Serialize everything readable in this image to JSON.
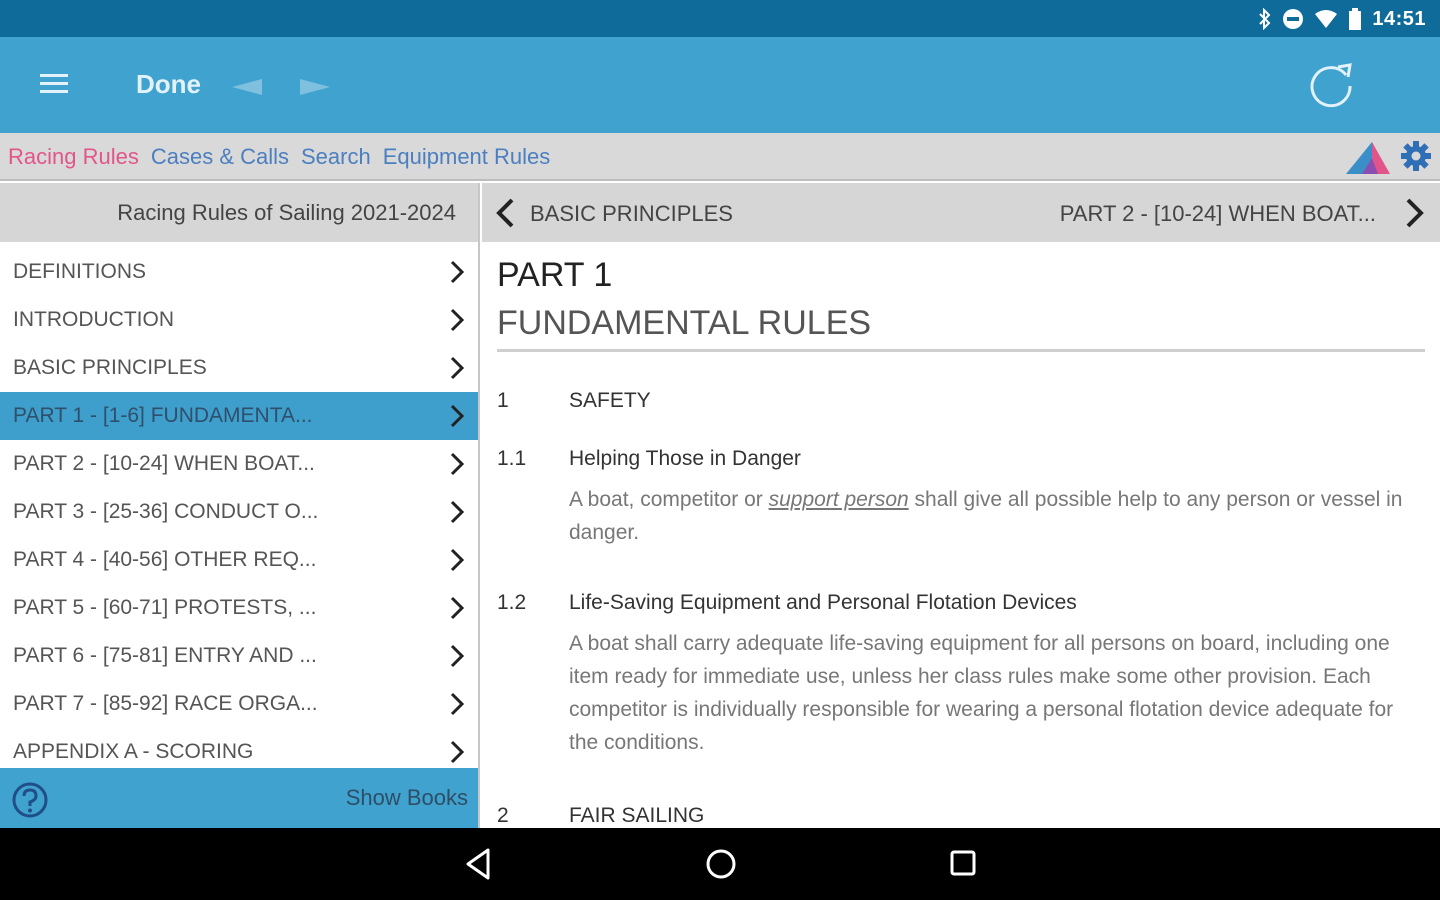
{
  "status_bar": {
    "time": "14:51",
    "icons": [
      "bluetooth-icon",
      "do-not-disturb-icon",
      "wifi-icon",
      "battery-icon"
    ]
  },
  "app_bar": {
    "menu_icon": "hamburger-menu-icon",
    "done_label": "Done",
    "back_icon": "arrow-left-icon",
    "forward_icon": "arrow-right-icon",
    "refresh_icon": "refresh-icon"
  },
  "tabs": [
    {
      "label": "Racing Rules",
      "active": true
    },
    {
      "label": "Cases & Calls",
      "active": false
    },
    {
      "label": "Search",
      "active": false
    },
    {
      "label": "Equipment Rules",
      "active": false
    }
  ],
  "sidebar": {
    "header": "Racing Rules of Sailing 2021-2024",
    "items": [
      {
        "label": "DEFINITIONS"
      },
      {
        "label": "INTRODUCTION"
      },
      {
        "label": "BASIC PRINCIPLES"
      },
      {
        "label": "PART 1 - [1-6] FUNDAMENTA..."
      },
      {
        "label": "PART 2 - [10-24] WHEN BOAT..."
      },
      {
        "label": "PART 3 - [25-36] CONDUCT O..."
      },
      {
        "label": "PART 4 - [40-56] OTHER REQ..."
      },
      {
        "label": "PART 5 - [60-71] PROTESTS, ..."
      },
      {
        "label": "PART 6 - [75-81] ENTRY AND ..."
      },
      {
        "label": "PART 7 - [85-92] RACE ORGA..."
      },
      {
        "label": "APPENDIX A - SCORING"
      }
    ],
    "selected_index": 3,
    "footer": {
      "help_icon": "help-icon",
      "show_books_label": "Show Books"
    }
  },
  "content": {
    "prev_label": "BASIC PRINCIPLES",
    "next_label": "PART 2 - [10-24] WHEN BOAT...",
    "part_number": "PART 1",
    "part_title": "FUNDAMENTAL RULES",
    "rules": {
      "safety": {
        "num": "1",
        "heading": "SAFETY"
      },
      "r11": {
        "num": "1.1",
        "heading": "Helping Those in Danger",
        "body_pre": "A boat, competitor or ",
        "body_term": "support person",
        "body_post": " shall give all possible help to any person or vessel in danger."
      },
      "r12": {
        "num": "1.2",
        "heading": "Life-Saving Equipment and Personal Flotation Devices",
        "body": "A boat shall carry adequate life-saving equipment for all persons on board, including one item ready for immediate use, unless her class rules make some other provision. Each competitor is individually responsible for wearing a personal flotation device adequate for the conditions."
      },
      "fair": {
        "num": "2",
        "heading": "FAIR SAILING"
      }
    }
  },
  "colors": {
    "status_bar": "#0f6b9a",
    "app_bar": "#40a2cf",
    "active_tab": "#e2558a",
    "tab": "#4b7fbf",
    "selected_row": "#3f9fcc"
  }
}
